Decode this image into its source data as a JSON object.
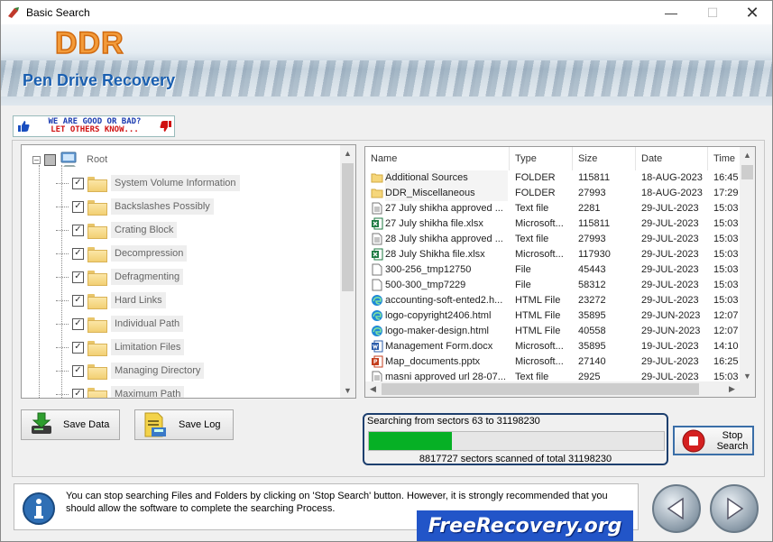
{
  "window": {
    "title": "Basic Search"
  },
  "banner": {
    "logo": "DDR",
    "product": "Pen Drive Recovery"
  },
  "rating": {
    "line1": "WE ARE GOOD OR BAD?",
    "line2": "LET OTHERS KNOW..."
  },
  "tree": {
    "root": "Root",
    "items": [
      "System Volume Information",
      "Backslashes Possibly",
      "Crating Block",
      "Decompression",
      "Defragmenting",
      "Hard Links",
      "Individual Path",
      "Limitation Files",
      "Managing Directory",
      "Maximum Path"
    ]
  },
  "list": {
    "columns": [
      "Name",
      "Type",
      "Size",
      "Date",
      "Time"
    ],
    "rows": [
      {
        "name": "Additional Sources",
        "type": "FOLDER",
        "size": "115811",
        "date": "18-AUG-2023",
        "time": "16:45",
        "icon": "folder-icon"
      },
      {
        "name": "DDR_Miscellaneous",
        "type": "FOLDER",
        "size": "27993",
        "date": "18-AUG-2023",
        "time": "17:29",
        "icon": "folder-icon"
      },
      {
        "name": "27 July shikha approved ...",
        "type": "Text file",
        "size": "2281",
        "date": "29-JUL-2023",
        "time": "15:03",
        "icon": "text-file-icon"
      },
      {
        "name": "27 July shikha file.xlsx",
        "type": "Microsoft...",
        "size": "115811",
        "date": "29-JUL-2023",
        "time": "15:03",
        "icon": "excel-file-icon"
      },
      {
        "name": "28 July shikha approved ...",
        "type": "Text file",
        "size": "27993",
        "date": "29-JUL-2023",
        "time": "15:03",
        "icon": "text-file-icon"
      },
      {
        "name": "28 July Shikha file.xlsx",
        "type": "Microsoft...",
        "size": "117930",
        "date": "29-JUL-2023",
        "time": "15:03",
        "icon": "excel-file-icon"
      },
      {
        "name": "300-256_tmp12750",
        "type": "File",
        "size": "45443",
        "date": "29-JUL-2023",
        "time": "15:03",
        "icon": "blank-file-icon"
      },
      {
        "name": "500-300_tmp7229",
        "type": "File",
        "size": "58312",
        "date": "29-JUL-2023",
        "time": "15:03",
        "icon": "blank-file-icon"
      },
      {
        "name": "accounting-soft-ented2.h...",
        "type": "HTML File",
        "size": "23272",
        "date": "29-JUL-2023",
        "time": "15:03",
        "icon": "edge-html-icon"
      },
      {
        "name": "logo-copyright2406.html",
        "type": "HTML File",
        "size": "35895",
        "date": "29-JUN-2023",
        "time": "12:07",
        "icon": "edge-html-icon"
      },
      {
        "name": "logo-maker-design.html",
        "type": "HTML File",
        "size": "40558",
        "date": "29-JUN-2023",
        "time": "12:07",
        "icon": "edge-html-icon"
      },
      {
        "name": "Management Form.docx",
        "type": "Microsoft...",
        "size": "35895",
        "date": "19-JUL-2023",
        "time": "14:10",
        "icon": "word-file-icon"
      },
      {
        "name": "Map_documents.pptx",
        "type": "Microsoft...",
        "size": "27140",
        "date": "29-JUL-2023",
        "time": "16:25",
        "icon": "powerpoint-file-icon"
      },
      {
        "name": "masni approved url 28-07...",
        "type": "Text file",
        "size": "2925",
        "date": "29-JUL-2023",
        "time": "15:03",
        "icon": "text-file-icon"
      }
    ]
  },
  "buttons": {
    "save_data": "Save Data",
    "save_log": "Save Log",
    "stop_line1": "Stop",
    "stop_line2": "Search"
  },
  "progress": {
    "status": "Searching from sectors   63 to 31198230",
    "scanned": "8817727  sectors scanned of total 31198230",
    "fraction": 0.2826,
    "color": "#06b025"
  },
  "info": {
    "text": "You can stop searching Files and Folders by clicking on 'Stop Search' button. However, it is strongly recommended that you should allow the software to complete the searching Process.",
    "brand": "FreeRecovery.org"
  }
}
